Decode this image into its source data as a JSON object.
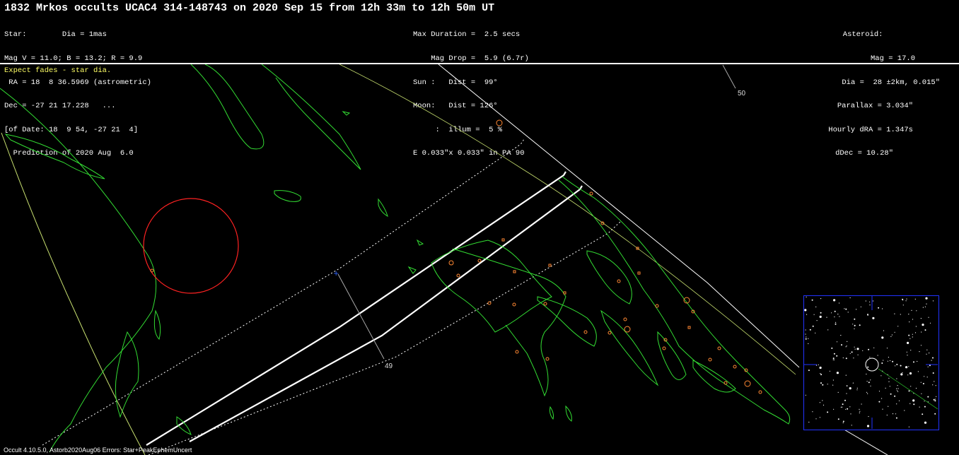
{
  "title": "1832 Mrkos occults UCAC4 314-148743 on 2020 Sep 15 from 12h 33m to 12h 50m UT",
  "star_info": [
    "Star:        Dia = 1mas",
    "Mag V = 11.0; B = 13.2; R = 9.9",
    " RA = 18  8 36.5969 (astrometric)",
    "Dec = -27 21 17.228   ...",
    "[of Date: 18  9 54, -27 21  4]",
    "  Prediction of 2020 Aug  6.0"
  ],
  "event_info": [
    "Max Duration =  2.5 secs",
    "    Mag Drop =  5.9 (6.7r)",
    "Sun :   Dist =  99°",
    "Moon:   Dist = 126°",
    "     :  illum =  5 %",
    "E 0.033\"x 0.033\" in PA 90"
  ],
  "asteroid_info": [
    "Asteroid:",
    "Mag = 17.0",
    "Dia =  28 ±2km, 0.015\"",
    "Parallax = 3.034\"",
    "Hourly dRA = 1.347s",
    "dDec = 10.28\""
  ],
  "note": "Expect fades - star dia.",
  "footer": "Occult 4.10.5.0, Astorb2020Aug06 Errors: Star+PeakEphemUncert",
  "map": {
    "tick_labels": [
      "50",
      "49"
    ],
    "colors": {
      "coastline": "#33dd33",
      "shadow_path": "#ffffff",
      "sigma_limit": "#ffffff",
      "horizon_limit": "#c8e070",
      "radio_telescope_ring": "#ff2222",
      "site_markers": "#ff8833",
      "center_marker": "#3366ff",
      "starchart_border": "#2233ff"
    }
  }
}
